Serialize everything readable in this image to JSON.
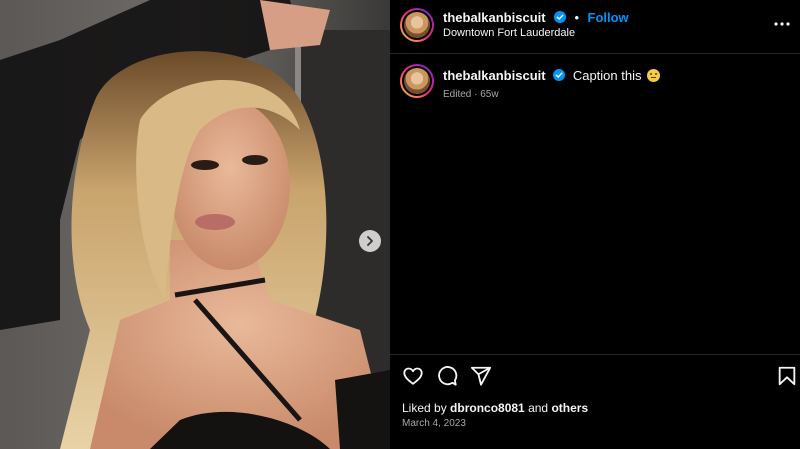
{
  "post": {
    "username": "thebalkanbiscuit",
    "follow_label": "Follow",
    "separator": "•",
    "location": "Downtown Fort Lauderdale",
    "caption": {
      "username": "thebalkanbiscuit",
      "text": "Caption this",
      "edited": "Edited",
      "dot": " · ",
      "age": "65w"
    },
    "likes": {
      "prefix": "Liked by ",
      "user": "dbronco8081",
      "middle": " and ",
      "others": "others"
    },
    "date": "March 4, 2023"
  },
  "icons": {
    "verified": "verified-badge-icon",
    "more": "more-options-icon",
    "like": "heart-icon",
    "comment": "comment-icon",
    "share": "share-icon",
    "save": "bookmark-icon",
    "next": "chevron-right-icon"
  },
  "colors": {
    "background": "#000000",
    "accent": "#0095f6",
    "secondary_text": "#a8a8a8",
    "divider": "#262626"
  }
}
